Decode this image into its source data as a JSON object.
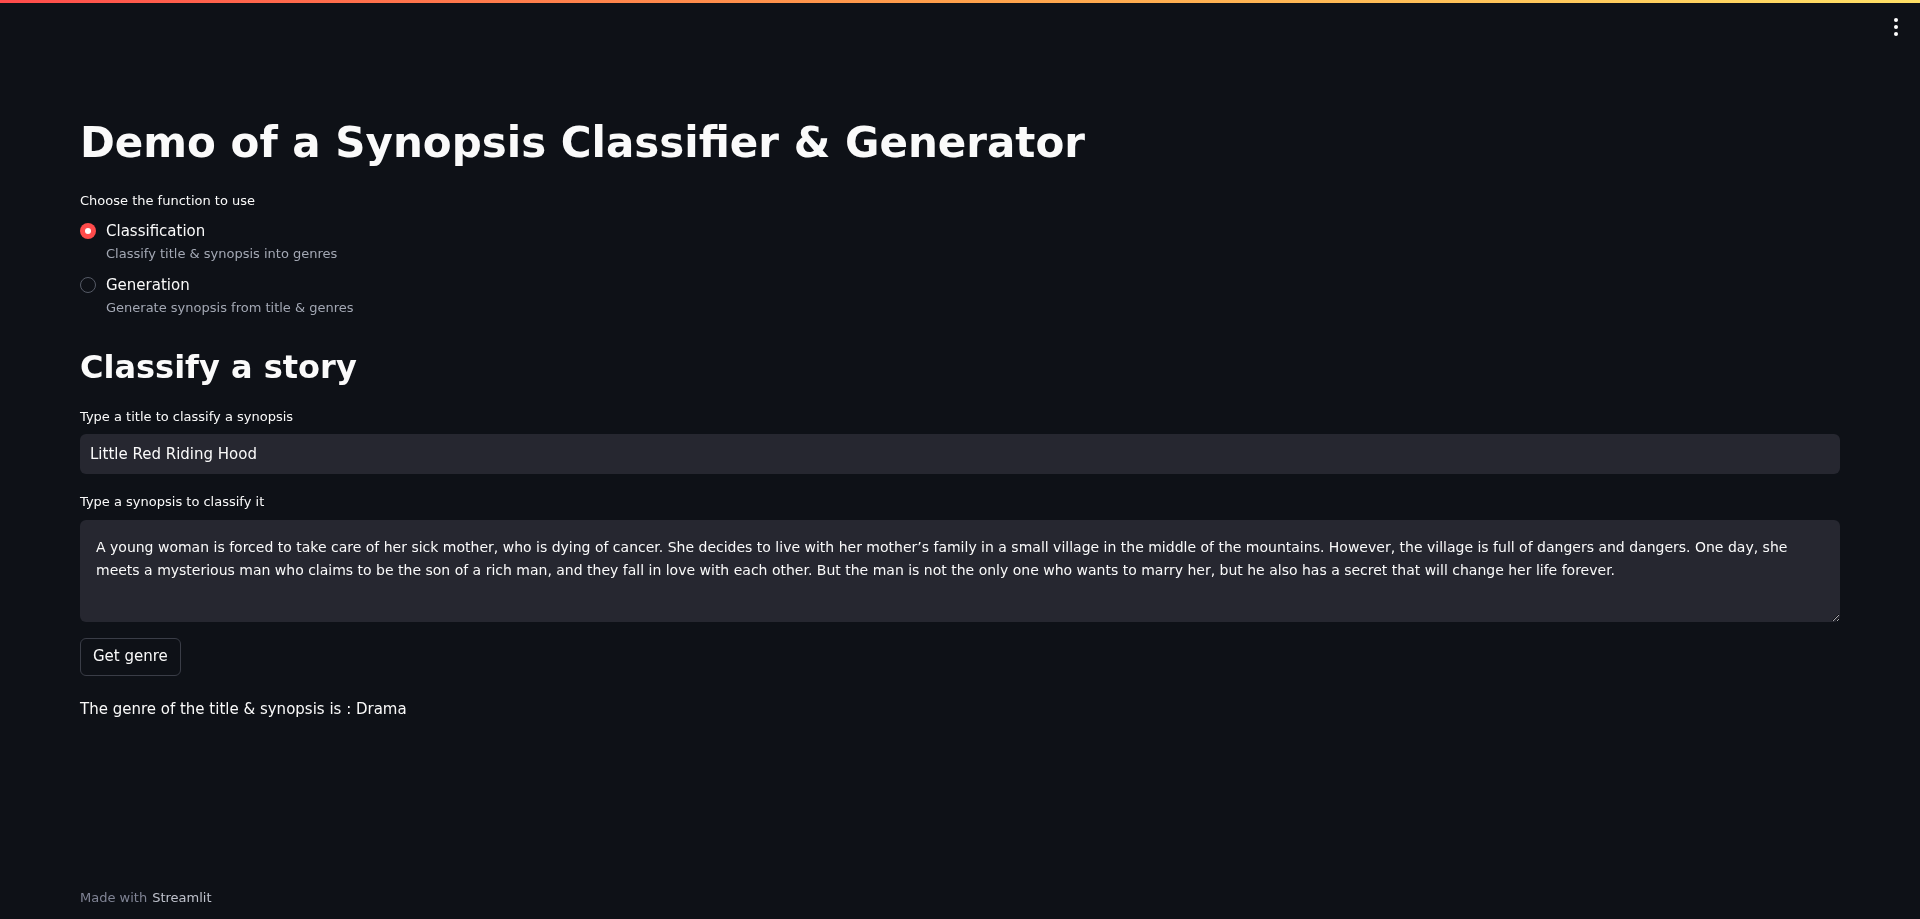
{
  "title": "Demo of a Synopsis Classifier & Generator",
  "function_choice": {
    "label": "Choose the function to use",
    "options": [
      {
        "label": "Classification",
        "caption": "Classify title & synopsis into genres",
        "selected": true
      },
      {
        "label": "Generation",
        "caption": "Generate synopsis from title & genres",
        "selected": false
      }
    ]
  },
  "section_heading": "Classify a story",
  "title_field": {
    "label": "Type a title to classify a synopsis",
    "value": "Little Red Riding Hood"
  },
  "synopsis_field": {
    "label": "Type a synopsis to classify it",
    "value": "A young woman is forced to take care of her sick mother, who is dying of cancer. She decides to live with her mother’s family in a small village in the middle of the mountains. However, the village is full of dangers and dangers. One day, she meets a mysterious man who claims to be the son of a rich man, and they fall in love with each other. But the man is not the only one who wants to marry her, but he also has a secret that will change her life forever."
  },
  "button": "Get genre",
  "result": "The genre of the title & synopsis is : Drama",
  "footer": {
    "prefix": "Made with",
    "link": "Streamlit"
  }
}
